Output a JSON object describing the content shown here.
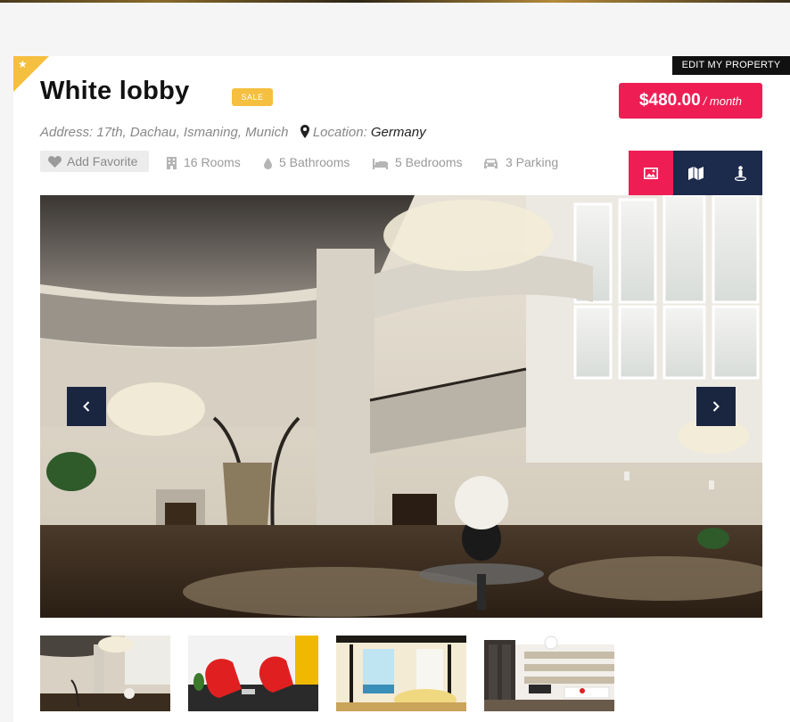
{
  "header": {
    "edit_label": "EDIT MY PROPERTY"
  },
  "property": {
    "title": "White lobby",
    "badge": "SALE",
    "price": "$480.00",
    "price_period": "/ month",
    "address": "Address: 17th, Dachau, Ismaning, Munich",
    "location_label": "Location:",
    "location_value": "Germany"
  },
  "actions": {
    "favorite_label": "Add Favorite"
  },
  "features": {
    "rooms": "16 Rooms",
    "bathrooms": "5 Bathrooms",
    "bedrooms": "5 Bedrooms",
    "parking": "3 Parking"
  },
  "view_tabs": [
    "photo-gallery",
    "map",
    "street-view"
  ],
  "gallery": {
    "thumbnails": [
      "lobby",
      "red-chairs",
      "bedroom",
      "living-room"
    ]
  },
  "colors": {
    "accent": "#ee1e55",
    "navy": "#1c2a4c",
    "badge": "#f5bf3f"
  }
}
